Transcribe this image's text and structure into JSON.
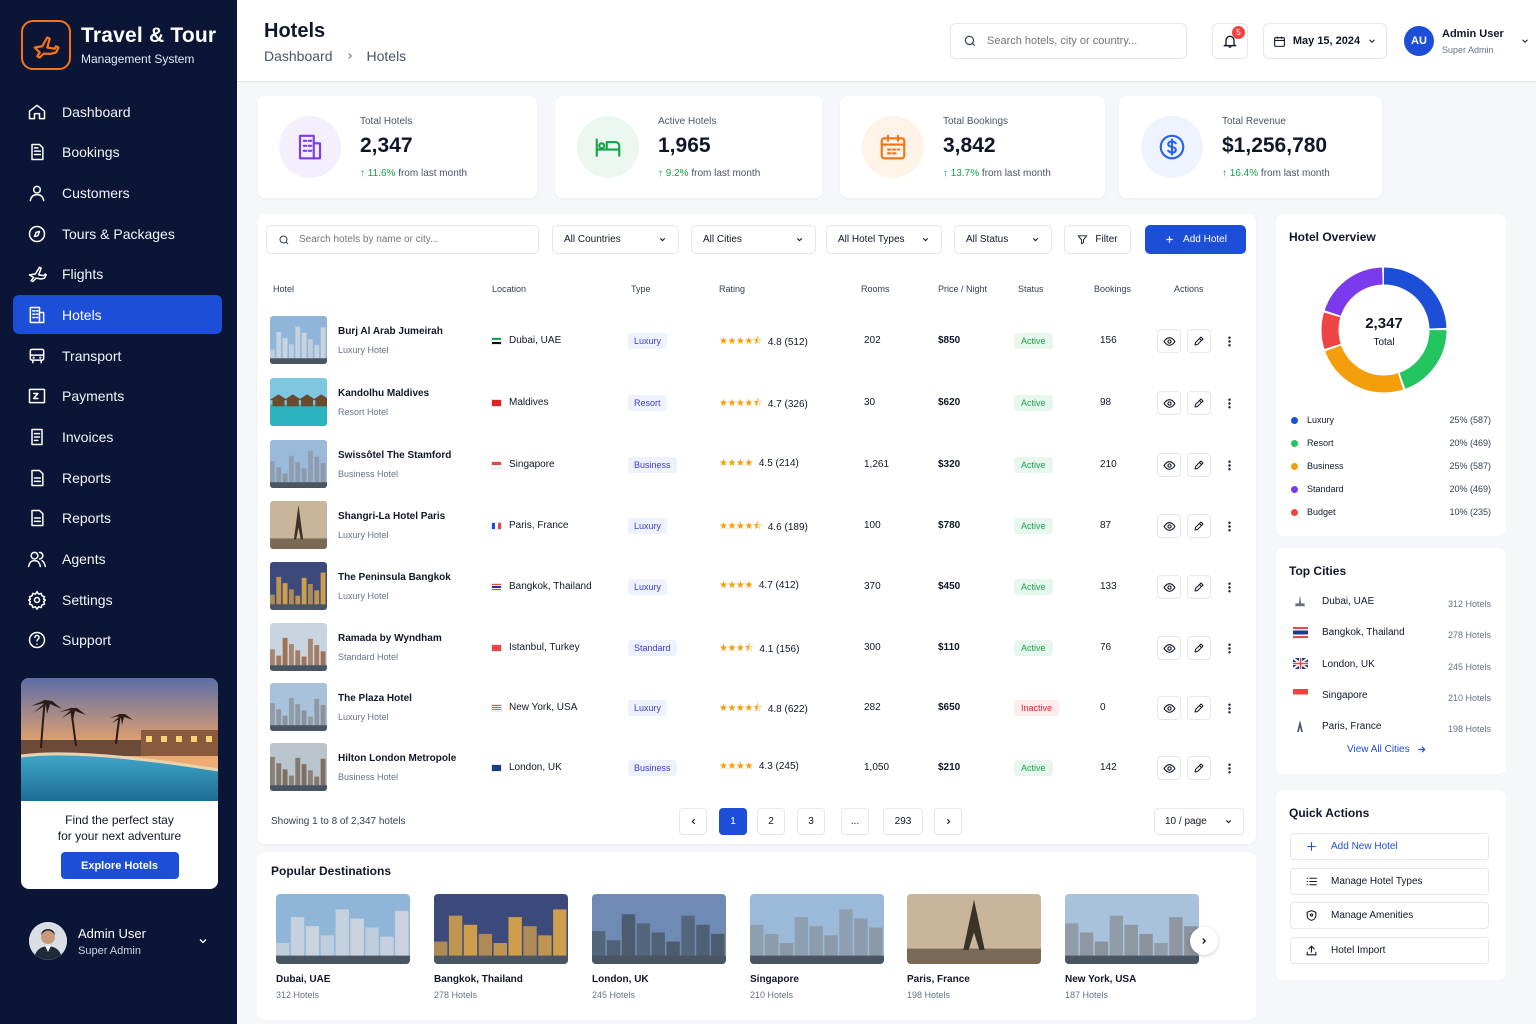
{
  "brand": {
    "title": "Travel & Tour",
    "subtitle": "Management System"
  },
  "nav": [
    {
      "label": "Dashboard",
      "icon": "home-icon"
    },
    {
      "label": "Bookings",
      "icon": "document-icon"
    },
    {
      "label": "Customers",
      "icon": "user-icon"
    },
    {
      "label": "Tours & Packages",
      "icon": "compass-icon"
    },
    {
      "label": "Flights",
      "icon": "plane-icon"
    },
    {
      "label": "Hotels",
      "icon": "building-icon",
      "active": true
    },
    {
      "label": "Transport",
      "icon": "bus-icon"
    },
    {
      "label": "Payments",
      "icon": "wallet-icon"
    },
    {
      "label": "Invoices",
      "icon": "invoice-icon"
    },
    {
      "label": "Reports",
      "icon": "report-icon"
    },
    {
      "label": "Reports",
      "icon": "report-icon"
    },
    {
      "label": "Agents",
      "icon": "users-icon"
    },
    {
      "label": "Settings",
      "icon": "gear-icon"
    },
    {
      "label": "Support",
      "icon": "help-icon"
    }
  ],
  "promo": {
    "line1": "Find the perfect stay",
    "line2": "for your next adventure",
    "button": "Explore Hotels"
  },
  "sidebar_user": {
    "name": "Admin User",
    "role": "Super Admin"
  },
  "header": {
    "title": "Hotels",
    "breadcrumb": [
      "Dashboard",
      "Hotels"
    ],
    "search_placeholder": "Search hotels, city or country...",
    "notifications": "5",
    "date": "May 15, 2024",
    "user": {
      "initials": "AU",
      "name": "Admin User",
      "role": "Super Admin"
    }
  },
  "stats": [
    {
      "label": "Total Hotels",
      "value": "2,347",
      "change": "11.6%",
      "suffix": "from last month",
      "icon": "building-icon",
      "color": "#7c3aed",
      "bg": "#f3effe"
    },
    {
      "label": "Active Hotels",
      "value": "1,965",
      "change": "9.2%",
      "suffix": "from last month",
      "icon": "bed-icon",
      "color": "#16a34a",
      "bg": "#ecf8ef"
    },
    {
      "label": "Total Bookings",
      "value": "3,842",
      "change": "13.7%",
      "suffix": "from last month",
      "icon": "calendar-icon",
      "color": "#f97316",
      "bg": "#fff3e8"
    },
    {
      "label": "Total Revenue",
      "value": "$1,256,780",
      "change": "16.4%",
      "suffix": "from last month",
      "icon": "dollar-icon",
      "color": "#2563eb",
      "bg": "#eef3fd"
    }
  ],
  "filters": {
    "search_placeholder": "Search hotels by name or city...",
    "countries": "All Countries",
    "cities": "All Cities",
    "types": "All Hotel Types",
    "status": "All Status",
    "filter": "Filter",
    "add": "Add Hotel"
  },
  "table": {
    "columns": [
      "Hotel",
      "Location",
      "Type",
      "Rating",
      "Rooms",
      "Price / Night",
      "Status",
      "Bookings",
      "Actions"
    ],
    "rows": [
      {
        "name": "Burj Al Arab Jumeirah",
        "category": "Luxury Hotel",
        "location": "Dubai, UAE",
        "flag": "ae",
        "type": "Luxury",
        "stars": "★★★★⯪",
        "rating": "4.8 (512)",
        "rooms": "202",
        "price": "$850",
        "status": "Active",
        "bookings": "156"
      },
      {
        "name": "Kandolhu Maldives",
        "category": "Resort Hotel",
        "location": "Maldives",
        "flag": "mv",
        "type": "Resort",
        "stars": "★★★★⯪",
        "rating": "4.7 (326)",
        "rooms": "30",
        "price": "$620",
        "status": "Active",
        "bookings": "98"
      },
      {
        "name": "Swissôtel The Stamford",
        "category": "Business Hotel",
        "location": "Singapore",
        "flag": "sg",
        "type": "Business",
        "stars": "★★★★",
        "rating": "4.5 (214)",
        "rooms": "1,261",
        "price": "$320",
        "status": "Active",
        "bookings": "210"
      },
      {
        "name": "Shangri-La Hotel Paris",
        "category": "Luxury Hotel",
        "location": "Paris, France",
        "flag": "fr",
        "type": "Luxury",
        "stars": "★★★★⯪",
        "rating": "4.6 (189)",
        "rooms": "100",
        "price": "$780",
        "status": "Active",
        "bookings": "87"
      },
      {
        "name": "The Peninsula Bangkok",
        "category": "Luxury Hotel",
        "location": "Bangkok, Thailand",
        "flag": "th",
        "type": "Luxury",
        "stars": "★★★★",
        "rating": "4.7 (412)",
        "rooms": "370",
        "price": "$450",
        "status": "Active",
        "bookings": "133"
      },
      {
        "name": "Ramada by Wyndham",
        "category": "Standard Hotel",
        "location": "Istanbul, Turkey",
        "flag": "tr",
        "type": "Standard",
        "stars": "★★★⯪",
        "rating": "4.1 (156)",
        "rooms": "300",
        "price": "$110",
        "status": "Active",
        "bookings": "76"
      },
      {
        "name": "The Plaza Hotel",
        "category": "Luxury Hotel",
        "location": "New York, USA",
        "flag": "us",
        "type": "Luxury",
        "stars": "★★★★⯪",
        "rating": "4.8 (622)",
        "rooms": "282",
        "price": "$650",
        "status": "Inactive",
        "bookings": "0"
      },
      {
        "name": "Hilton London Metropole",
        "category": "Business Hotel",
        "location": "London, UK",
        "flag": "gb",
        "type": "Business",
        "stars": "★★★★",
        "rating": "4.3 (245)",
        "rooms": "1,050",
        "price": "$210",
        "status": "Active",
        "bookings": "142"
      }
    ],
    "footer": "Showing 1 to 8 of 2,347 hotels",
    "pages": [
      "1",
      "2",
      "3",
      "...",
      "293"
    ],
    "per_page": "10 / page"
  },
  "destinations": {
    "title": "Popular Destinations",
    "items": [
      {
        "name": "Dubai, UAE",
        "count": "312 Hotels"
      },
      {
        "name": "Bangkok, Thailand",
        "count": "278 Hotels"
      },
      {
        "name": "London, UK",
        "count": "245 Hotels"
      },
      {
        "name": "Singapore",
        "count": "210 Hotels"
      },
      {
        "name": "Paris, France",
        "count": "198 Hotels"
      },
      {
        "name": "New York, USA",
        "count": "187 Hotels"
      }
    ]
  },
  "overview": {
    "title": "Hotel Overview",
    "center_value": "2,347",
    "center_label": "Total",
    "legend": [
      {
        "label": "Luxury",
        "pct": "25% (587)",
        "color": "#1d4ed8"
      },
      {
        "label": "Resort",
        "pct": "20% (469)",
        "color": "#22c55e"
      },
      {
        "label": "Business",
        "pct": "25% (587)",
        "color": "#f59e0b"
      },
      {
        "label": "Standard",
        "pct": "20% (469)",
        "color": "#7c3aed"
      },
      {
        "label": "Budget",
        "pct": "10% (235)",
        "color": "#ef4444"
      }
    ]
  },
  "chart_data": {
    "type": "pie",
    "categories": [
      "Luxury",
      "Resort",
      "Business",
      "Standard",
      "Budget"
    ],
    "values": [
      587,
      469,
      587,
      469,
      235
    ],
    "colors": [
      "#1d4ed8",
      "#22c55e",
      "#f59e0b",
      "#7c3aed",
      "#ef4444"
    ]
  },
  "top_cities": {
    "title": "Top Cities",
    "items": [
      {
        "name": "Dubai, UAE",
        "count": "312 Hotels"
      },
      {
        "name": "Bangkok, Thailand",
        "count": "278 Hotels"
      },
      {
        "name": "London, UK",
        "count": "245 Hotels"
      },
      {
        "name": "Singapore",
        "count": "210 Hotels"
      },
      {
        "name": "Paris, France",
        "count": "198 Hotels"
      }
    ],
    "view_all": "View All Cities"
  },
  "quick_actions": {
    "title": "Quick Actions",
    "items": [
      {
        "label": "Add New Hotel",
        "icon": "plus-icon"
      },
      {
        "label": "Manage Hotel Types",
        "icon": "list-icon"
      },
      {
        "label": "Manage Amenities",
        "icon": "shield-icon"
      },
      {
        "label": "Hotel Import",
        "icon": "upload-icon"
      }
    ]
  }
}
